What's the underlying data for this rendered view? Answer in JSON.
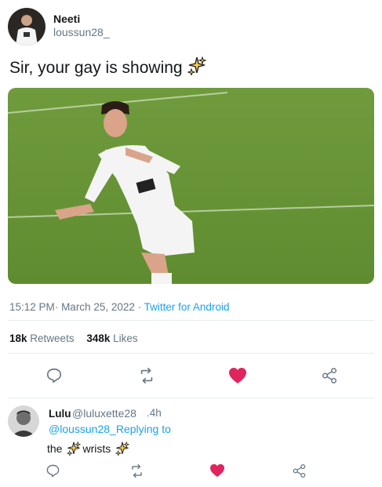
{
  "tweet": {
    "author_name": "Neeti",
    "author_handle": "loussun28_",
    "text": "Sir, your gay is showing",
    "emoji_icon": "sparkles-icon",
    "time": "15:12 PM",
    "date": "March 25, 2022",
    "separator": "·",
    "source": "Twitter for Android",
    "retweets_count": "18k",
    "retweets_label": "Retweets",
    "likes_count": "348k",
    "likes_label": "Likes"
  },
  "reply": {
    "author_name": "Lulu",
    "author_handle": "@luluxette28",
    "time": ".4h",
    "mention": "@loussun28_",
    "replying_label": "Replying to",
    "text_before": "the",
    "text_middle": "wrists"
  },
  "colors": {
    "accent": "#1da1f2",
    "like_active": "#e0245e",
    "muted": "#657786",
    "divider": "#e6ecf0"
  }
}
